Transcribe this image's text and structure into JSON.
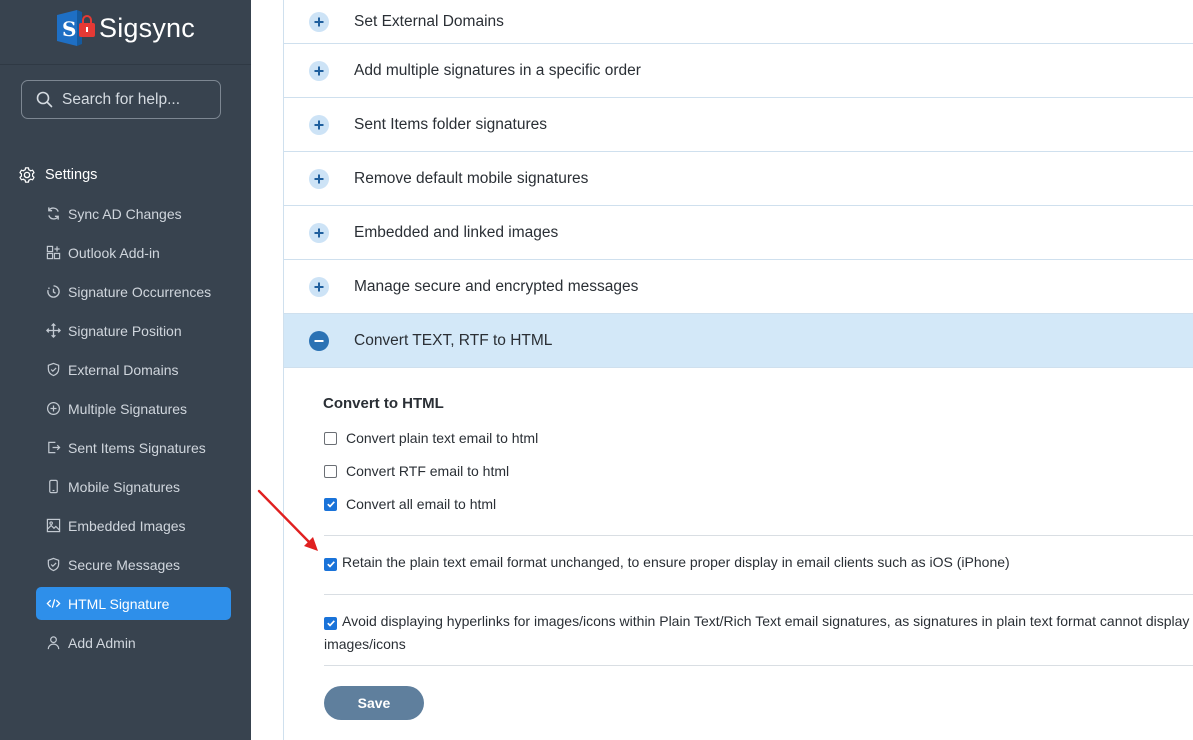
{
  "app": {
    "logo_text": "Sigsync",
    "search_placeholder": "Search for help..."
  },
  "sidebar": {
    "section": "Settings",
    "items": [
      {
        "label": "Sync AD Changes",
        "icon": "sync-icon"
      },
      {
        "label": "Outlook Add-in",
        "icon": "add-in-icon"
      },
      {
        "label": "Signature Occurrences",
        "icon": "occurrence-icon"
      },
      {
        "label": "Signature Position",
        "icon": "move-icon"
      },
      {
        "label": "External Domains",
        "icon": "shield-icon"
      },
      {
        "label": "Multiple Signatures",
        "icon": "plus-circle-icon"
      },
      {
        "label": "Sent Items Signatures",
        "icon": "sent-icon"
      },
      {
        "label": "Mobile Signatures",
        "icon": "mobile-icon"
      },
      {
        "label": "Embedded Images",
        "icon": "image-icon"
      },
      {
        "label": "Secure Messages",
        "icon": "shield-check-icon"
      },
      {
        "label": "HTML Signature",
        "icon": "code-icon",
        "active": true
      },
      {
        "label": "Add Admin",
        "icon": "user-icon"
      }
    ]
  },
  "accordion": [
    {
      "title": "Set External Domains"
    },
    {
      "title": "Add multiple signatures in a specific order"
    },
    {
      "title": "Sent Items folder signatures"
    },
    {
      "title": "Remove default mobile signatures"
    },
    {
      "title": "Embedded and linked images"
    },
    {
      "title": "Manage secure and encrypted messages"
    },
    {
      "title": "Convert TEXT, RTF to HTML",
      "open": true
    }
  ],
  "panel": {
    "title": "Convert to HTML",
    "options": [
      {
        "label": "Convert plain text email to html",
        "checked": false
      },
      {
        "label": "Convert RTF email to html",
        "checked": false
      },
      {
        "label": "Convert all email to html",
        "checked": true
      }
    ],
    "retain_label": "Retain the plain text email format unchanged, to ensure proper display in email clients such as iOS (iPhone)",
    "retain_checked": true,
    "avoid_label": "Avoid displaying hyperlinks for images/icons within Plain Text/Rich Text email signatures, as signatures in plain text format cannot display images/icons",
    "avoid_checked": true,
    "save_label": "Save"
  },
  "colors": {
    "sidebar_bg": "#38434f",
    "accent": "#2e8fea",
    "open_row_bg": "#d3e8f8",
    "save_bg": "#5f7f9d",
    "arrow": "#e02020"
  }
}
